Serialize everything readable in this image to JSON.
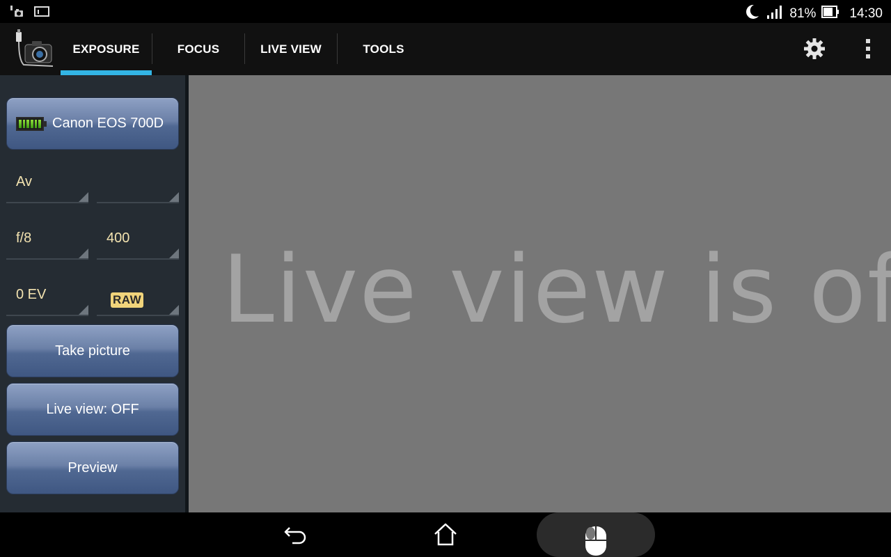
{
  "status_bar": {
    "battery_percent": "81%",
    "time": "14:30",
    "icons": [
      "usb-camera-notification-icon",
      "screen-notification-icon",
      "moon-icon",
      "signal-icon",
      "battery-icon"
    ]
  },
  "action_bar": {
    "tabs": [
      {
        "label": "EXPOSURE",
        "active": true
      },
      {
        "label": "FOCUS",
        "active": false
      },
      {
        "label": "LIVE VIEW",
        "active": false
      },
      {
        "label": "TOOLS",
        "active": false
      }
    ],
    "accent_color": "#33b5e5",
    "icons": [
      "app-camera-icon",
      "settings-gear-icon",
      "overflow-menu-icon"
    ]
  },
  "panel": {
    "camera_name": "Canon EOS 700D",
    "mode": "Av",
    "mode_right": "",
    "aperture": "f/8",
    "iso": "400",
    "exposure_comp": "0 EV",
    "quality_badge": "RAW",
    "take_picture_label": "Take picture",
    "live_view_label": "Live view: OFF",
    "preview_label": "Preview"
  },
  "main": {
    "message": "Live view is off"
  },
  "nav_bar": {
    "icons": [
      "back-icon",
      "home-icon",
      "mouse-icon"
    ]
  }
}
